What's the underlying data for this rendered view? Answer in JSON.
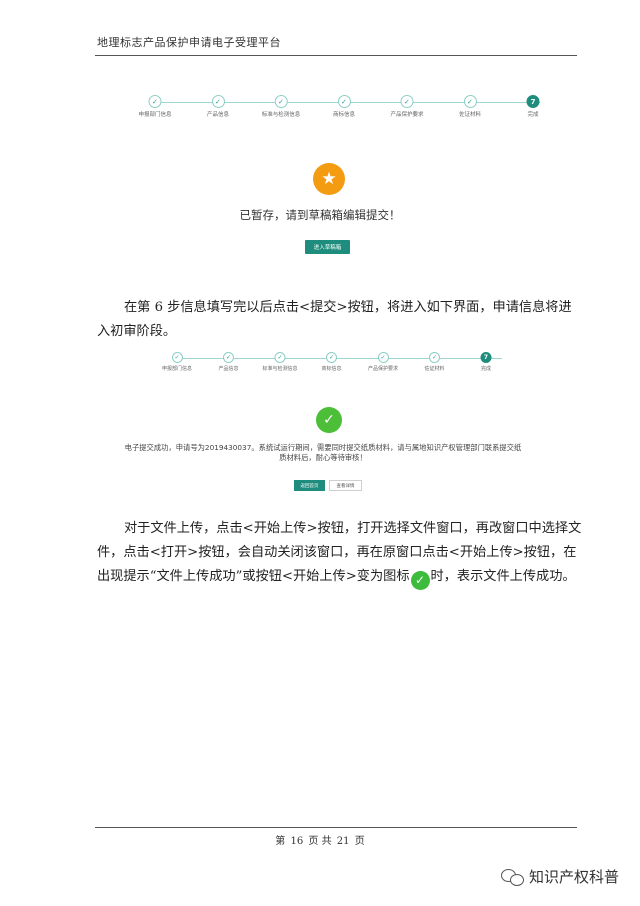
{
  "header": {
    "title": "地理标志产品保护申请电子受理平台"
  },
  "steps": [
    "申报部门信息",
    "产品信息",
    "标准与检测信息",
    "商标信息",
    "产品保护要求",
    "佐证材料",
    "完成"
  ],
  "final_step_number": "7",
  "step_check_glyph": "✓",
  "screenshot1": {
    "icon": "star-icon",
    "icon_color": "#f39c12",
    "icon_glyph": "★",
    "message": "已暂存，请到草稿箱编辑提交！",
    "button_label": "进入草稿箱"
  },
  "paragraph1": {
    "text": "在第 6 步信息填写完以后点击<提交>按钮，将进入如下界面，申请信息将进入初审阶段。"
  },
  "screenshot2": {
    "icon": "check-icon",
    "icon_color": "#4cbe38",
    "icon_glyph": "✓",
    "message_line1": "电子提交成功，申请号为2019430037。系统试运行期间，需要同时提交纸质材料，请与属地知识产权管理部门联系提交纸",
    "message_line2": "质材料后，耐心等待审核！",
    "button_primary": "返回首页",
    "button_secondary": "查看详情"
  },
  "paragraph2": {
    "text_before_icon": "对于文件上传，点击<开始上传>按钮，打开选择文件窗口，再改窗口中选择文件，点击<打开>按钮，会自动关闭该窗口，再在原窗口点击<开始上传>按钮，在出现提示“文件上传成功”或按钮<开始上传>变为图标",
    "icon_glyph": "✓",
    "text_after_icon": "时，表示文件上传成功。"
  },
  "footer": {
    "page_prefix": "第",
    "page_number": "16",
    "page_mid": "页 共",
    "total_pages": "21",
    "page_suffix": "页"
  },
  "watermark": {
    "text": "知识产权科普",
    "icon": "wechat-icon"
  },
  "colors": {
    "accent": "#1f8d7d",
    "step_line": "#9fd6cf",
    "star": "#f39c12",
    "check": "#4cbe38"
  }
}
